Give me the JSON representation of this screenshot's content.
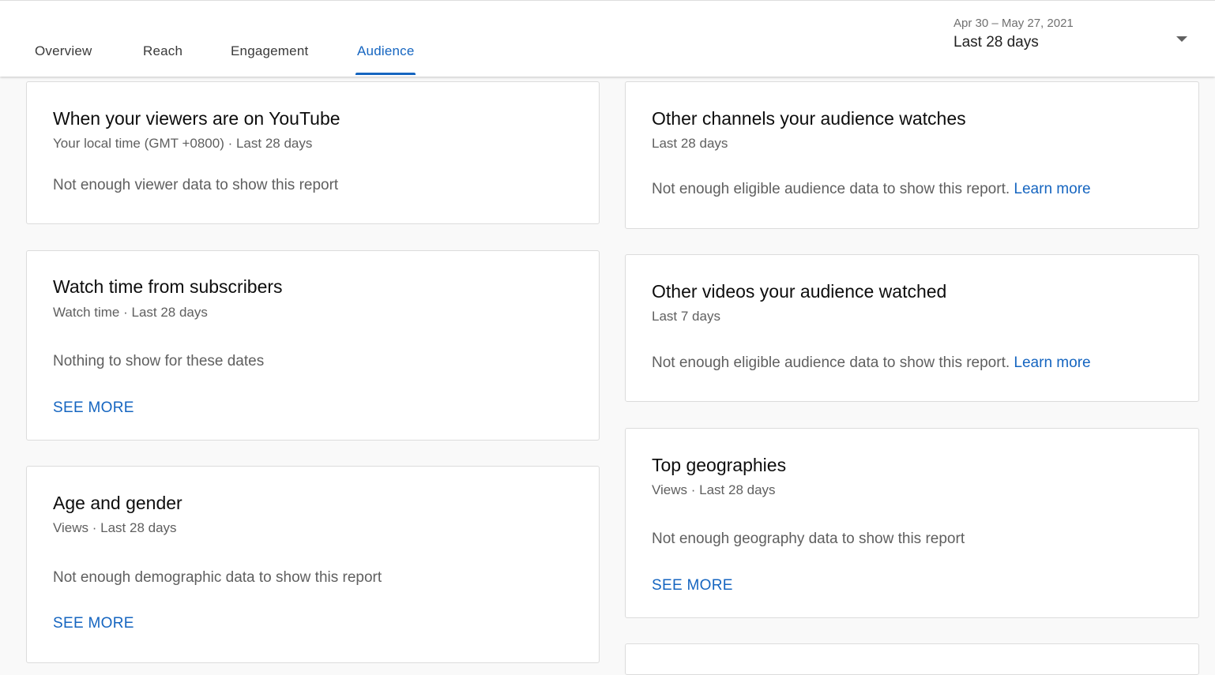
{
  "tabs": [
    {
      "label": "Overview",
      "active": false
    },
    {
      "label": "Reach",
      "active": false
    },
    {
      "label": "Engagement",
      "active": false
    },
    {
      "label": "Audience",
      "active": true
    }
  ],
  "date_picker": {
    "range": "Apr 30 – May 27, 2021",
    "label": "Last 28 days"
  },
  "cards": {
    "viewers_time": {
      "title": "When your viewers are on YouTube",
      "subtitle": "Your local time (GMT +0800) · Last 28 days",
      "message": "Not enough viewer data to show this report"
    },
    "subscribers": {
      "title": "Watch time from subscribers",
      "subtitle": "Watch time · Last 28 days",
      "message": "Nothing to show for these dates",
      "link": "SEE MORE"
    },
    "age_gender": {
      "title": "Age and gender",
      "subtitle": "Views · Last 28 days",
      "message": "Not enough demographic data to show this report",
      "link": "SEE MORE"
    },
    "other_channels": {
      "title": "Other channels your audience watches",
      "subtitle": "Last 28 days",
      "message": "Not enough eligible audience data to show this report.",
      "link": "Learn more"
    },
    "other_videos": {
      "title": "Other videos your audience watched",
      "subtitle": "Last 7 days",
      "message": "Not enough eligible audience data to show this report.",
      "link": "Learn more"
    },
    "geographies": {
      "title": "Top geographies",
      "subtitle": "Views · Last 28 days",
      "message": "Not enough geography data to show this report",
      "link": "SEE MORE"
    }
  },
  "colors": {
    "accent": "#1565c0",
    "text_secondary": "#5f5f5f",
    "background": "#f9f9f9"
  }
}
